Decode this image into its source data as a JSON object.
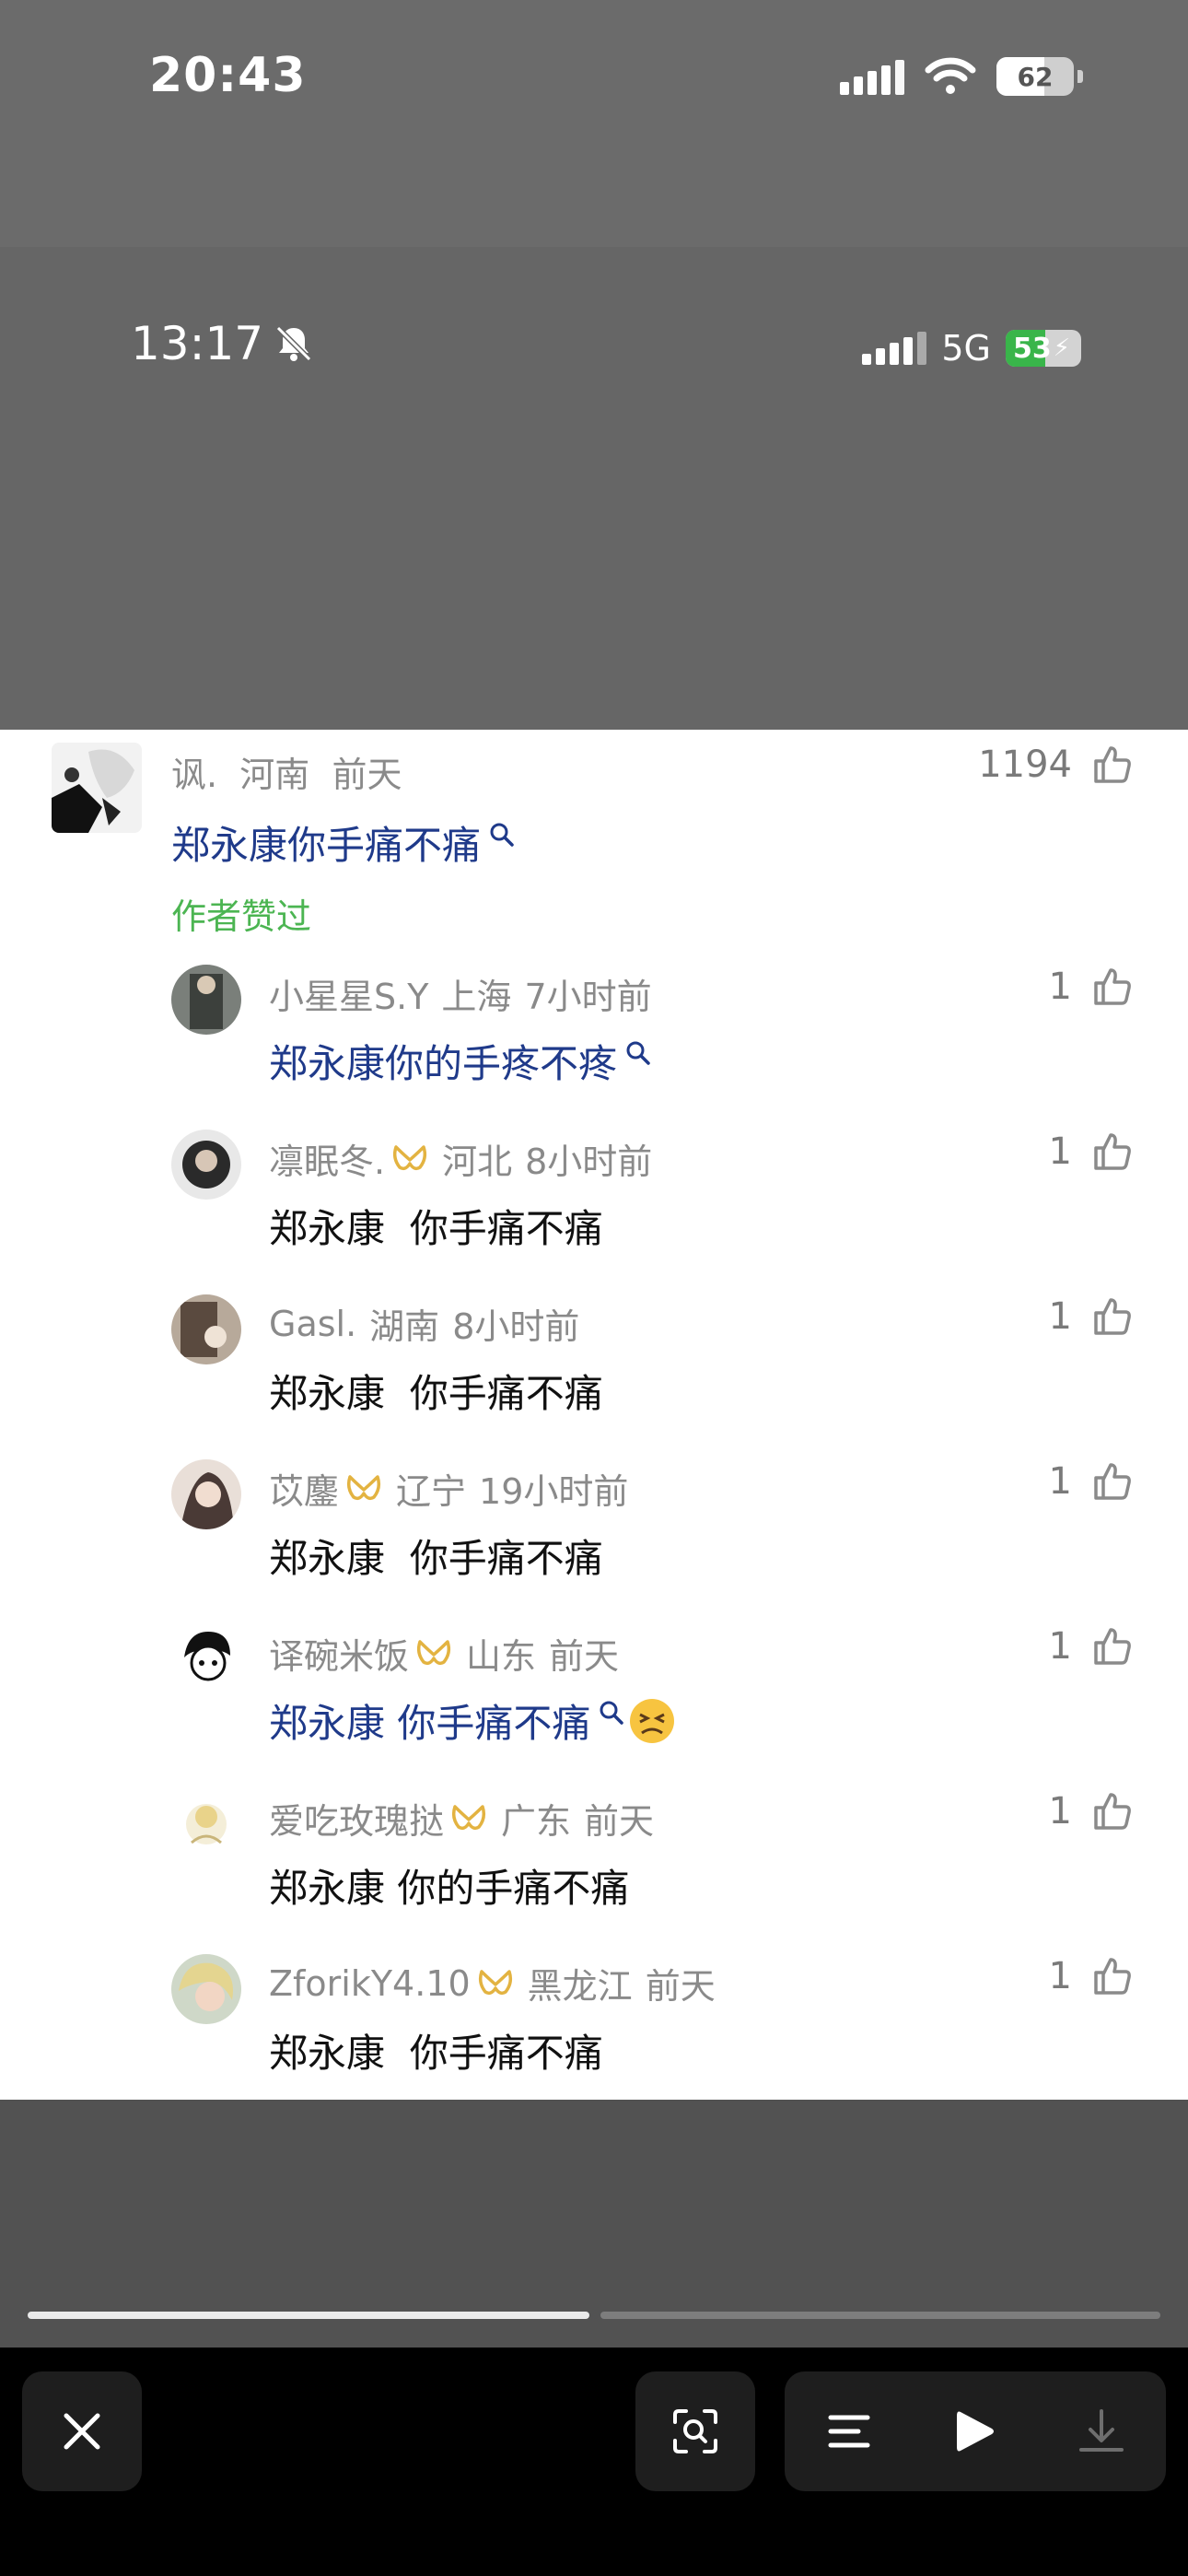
{
  "outer_status": {
    "time": "20:43",
    "battery": "62",
    "battery_fraction": 0.62
  },
  "inner_status": {
    "time": "13:17",
    "network": "5G",
    "battery": "53",
    "battery_fraction": 0.53
  },
  "main_comment": {
    "username": "讽.",
    "location": "河南",
    "time": "前天",
    "likes": "1194",
    "text": "郑永康你手痛不痛",
    "author_liked": "作者赞过"
  },
  "replies": [
    {
      "username": "小星星S.Y",
      "location": "上海",
      "time": "7小时前",
      "likes": "1",
      "text": "郑永康你的手疼不疼",
      "linked": true,
      "vip": false,
      "emoji": false
    },
    {
      "username": "凛眠冬.",
      "location": "河北",
      "time": "8小时前",
      "likes": "1",
      "text": "郑永康  你手痛不痛",
      "linked": false,
      "vip": true,
      "emoji": false
    },
    {
      "username": "Gasl.",
      "location": "湖南",
      "time": "8小时前",
      "likes": "1",
      "text": "郑永康  你手痛不痛",
      "linked": false,
      "vip": false,
      "emoji": false
    },
    {
      "username": "苡鏖",
      "location": "辽宁",
      "time": "19小时前",
      "likes": "1",
      "text": "郑永康  你手痛不痛",
      "linked": false,
      "vip": true,
      "emoji": false
    },
    {
      "username": "译碗米饭",
      "location": "山东",
      "time": "前天",
      "likes": "1",
      "text": "郑永康 你手痛不痛",
      "linked": true,
      "vip": true,
      "emoji": true
    },
    {
      "username": "爱吃玫瑰挞",
      "location": "广东",
      "time": "前天",
      "likes": "1",
      "text": "郑永康 你的手痛不痛",
      "linked": false,
      "vip": true,
      "emoji": false
    },
    {
      "username": "ZforikY4.10",
      "location": "黑龙江",
      "time": "前天",
      "likes": "1",
      "text": "郑永康  你手痛不痛",
      "linked": false,
      "vip": true,
      "emoji": false
    }
  ],
  "viewer": {
    "page_progress": 0.5
  },
  "colors": {
    "link": "#1f3a8a",
    "author_liked": "#4cb552",
    "vip": "#e3b341",
    "battery_green": "#39b54a"
  },
  "icons": {
    "close": "close-icon",
    "scan": "text-scan-icon",
    "list": "list-icon",
    "play": "play-icon",
    "download": "download-icon",
    "like": "thumb-up-icon",
    "search": "search-icon",
    "vip": "vip-badge-icon",
    "mute": "bell-slash-icon"
  }
}
